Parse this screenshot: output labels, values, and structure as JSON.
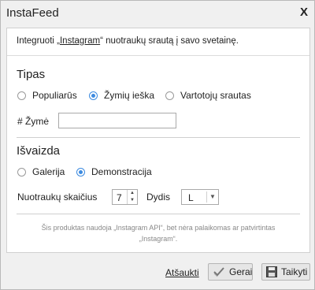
{
  "dialog": {
    "title": "InstaFeed",
    "close_label": "X"
  },
  "intro": {
    "before": "Integruoti „",
    "link": "Instagram",
    "after": "“ nuotraukų srautą į savo svetainę."
  },
  "tipas": {
    "heading": "Tipas",
    "options": [
      {
        "label": "Populiarūs",
        "selected": false
      },
      {
        "label": "Žymių ieška",
        "selected": true
      },
      {
        "label": "Vartotojų srautas",
        "selected": false
      }
    ],
    "tag_label": "# Žymė",
    "tag_value": ""
  },
  "isvaizda": {
    "heading": "Išvaizda",
    "options": [
      {
        "label": "Galerija",
        "selected": false
      },
      {
        "label": "Demonstracija",
        "selected": true
      }
    ],
    "count_label": "Nuotraukų skaičius",
    "count_value": "7",
    "size_label": "Dydis",
    "size_value": "L"
  },
  "disclaimer": {
    "line1": "Šis produktas naudoja „Instagram API“, bet nėra palaikomas ar patvirtintas",
    "line2": "„Instagram“."
  },
  "footer": {
    "cancel_label": "Atšaukti",
    "ok_label": "Gerai",
    "apply_label": "Taikyti"
  },
  "icons": {
    "ok": "checkmark-icon",
    "apply": "floppy-disk-icon"
  }
}
